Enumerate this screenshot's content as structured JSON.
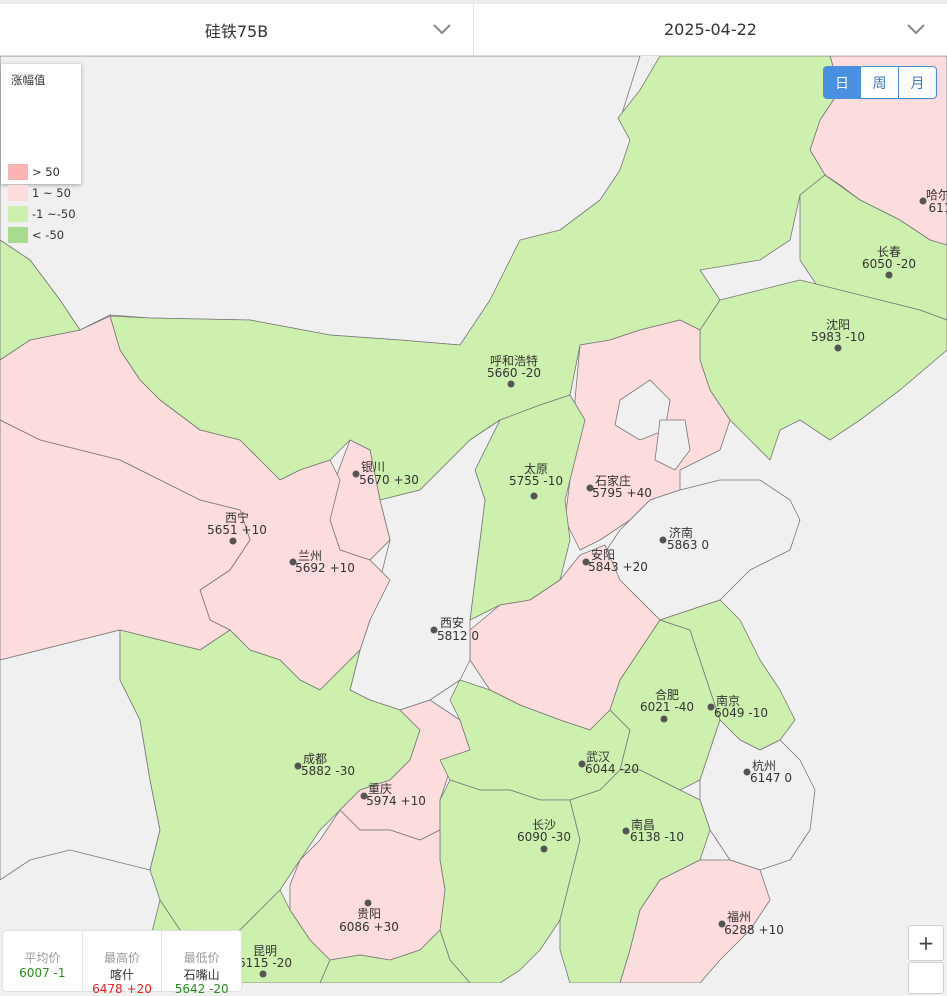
{
  "header": {
    "product": "硅铁75B",
    "date": "2025-04-22"
  },
  "legend": {
    "title": "涨幅值",
    "items": [
      {
        "label": "> 50",
        "color": "#fbb4b4"
      },
      {
        "label": "1 ~ 50",
        "color": "#fcdcdc"
      },
      {
        "label": "-1 ~-50",
        "color": "#cdf0ae"
      },
      {
        "label": "< -50",
        "color": "#a8db8c"
      }
    ]
  },
  "periods": [
    "日",
    "周",
    "月"
  ],
  "active_period": "日",
  "zoom": {
    "in_label": "+"
  },
  "stats": {
    "avg_label": "平均价",
    "avg_value": "6007 -1",
    "max_label": "最高价",
    "max_city": "喀什",
    "max_value": "6478 +20",
    "min_label": "最低价",
    "min_city": "石嘴山",
    "min_value": "5642 -20"
  },
  "colors": {
    "up_small": "#fcdcdc",
    "down_small": "#cdf0ae",
    "neutral": "#f0f0f0",
    "border": "#777777",
    "active_blue": "#4a90e2"
  },
  "cities": [
    {
      "name": "哈尔",
      "price": "611"
    },
    {
      "name": "长春",
      "price": "6050 -20"
    },
    {
      "name": "沈阳",
      "price": "5983 -10"
    },
    {
      "name": "呼和浩特",
      "price": "5660 -20"
    },
    {
      "name": "银川",
      "price": "5670 +30"
    },
    {
      "name": "太原",
      "price": "5755 -10"
    },
    {
      "name": "石家庄",
      "price": "5795 +40"
    },
    {
      "name": "西宁",
      "price": "5651 +10"
    },
    {
      "name": "兰州",
      "price": "5692 +10"
    },
    {
      "name": "济南",
      "price": "5863 0"
    },
    {
      "name": "安阳",
      "price": "5843 +20"
    },
    {
      "name": "西安",
      "price": "5812 0"
    },
    {
      "name": "合肥",
      "price": "6021 -40"
    },
    {
      "name": "南京",
      "price": "6049 -10"
    },
    {
      "name": "成都",
      "price": "5882 -30"
    },
    {
      "name": "武汉",
      "price": "6044 -20"
    },
    {
      "name": "杭州",
      "price": "6147 0"
    },
    {
      "name": "重庆",
      "price": "5974 +10"
    },
    {
      "name": "长沙",
      "price": "6090 -30"
    },
    {
      "name": "南昌",
      "price": "6138 -10"
    },
    {
      "name": "贵阳",
      "price": "6086 +30"
    },
    {
      "name": "福州",
      "price": "6288 +10"
    },
    {
      "name": "昆明",
      "price": "6115 -20"
    }
  ]
}
